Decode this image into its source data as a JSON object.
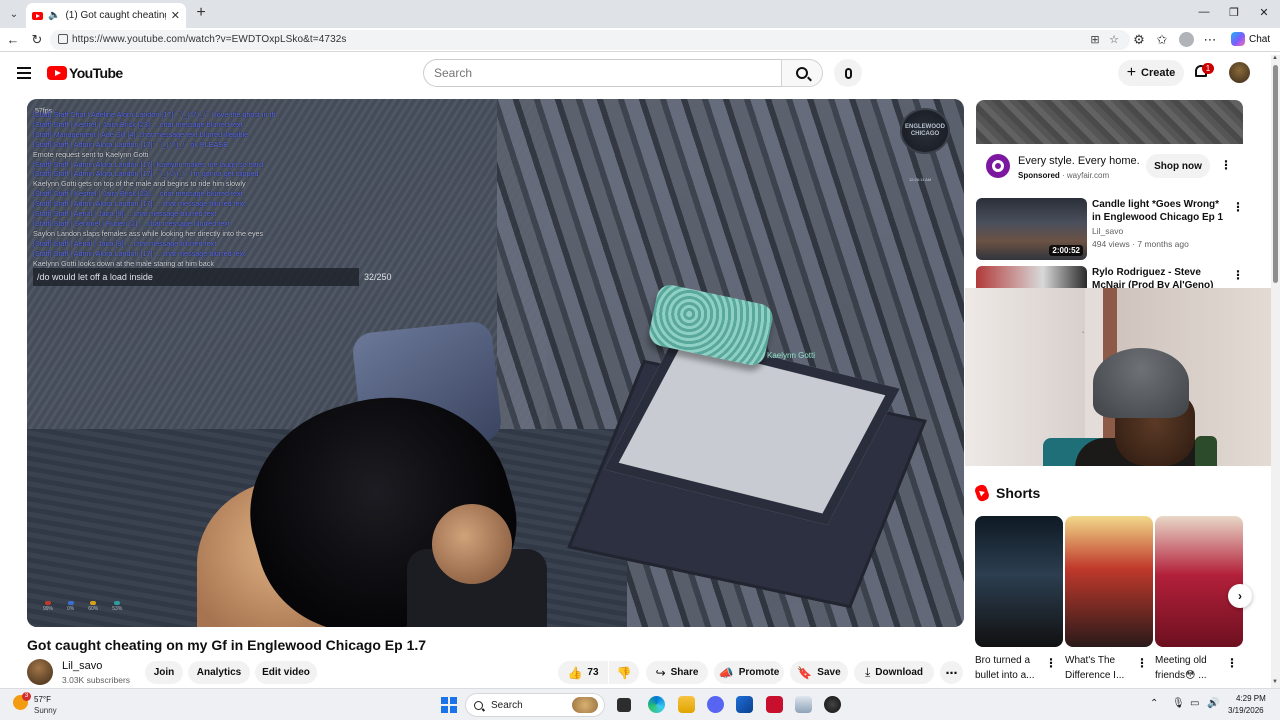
{
  "browser": {
    "tab_title": "(1) Got caught cheating on my Gf in Englewood Chicago Ep 1.7",
    "url": "https://www.youtube.com/watch?v=EWDTOxpLSko&t=4732s",
    "copilot_label": "Chat"
  },
  "header": {
    "logo_text": "YouTube",
    "search_placeholder": "Search",
    "create_label": "Create",
    "notification_count": "1"
  },
  "game_hud": {
    "fps": "57fps",
    "chat_lines": [
      "[Staff] Staff Chat | Adeline Alora Landon [17]: ¯\\_(ツ)_/¯ I love the ghost in th",
      "[Staff] Staff | Kestrel | Jaira Brisk [23]: ...chat message blurred text",
      "[Staff] Management | Ade Sill [4]: chat message text blurred illegible",
      "[Staff] Staff | Admin Alora Landon [17]: ¯\\_(ツ)_/¯ ok PLEASE",
      "Emote request sent to Kaelynn Gotti",
      "[Staff] Staff | Admin Alora Landon [17]: Kaelynn makes me laugh so hard",
      "[Staff] Staff | Admin Alora Landon [17]: ¯\\_(ツ)_/¯ I'm gonna get clipped",
      "Kaelynn Gotti gets on top of the male and begins to ride him slowly",
      "[Staff] Staff | Kestrel | Jaira Brisk [23]: ...chat message blurred text",
      "[Staff] Staff | Admin Alora Landon [17]: ...chat message blurred text",
      "[Staff] Staff | Aerial | Jaira [9]: ...chat message blurred text",
      "[Staff] Staff | Sentinel | Ruben [2]: ...chat message blurred text",
      "Saylon Landon slaps females ass while looking her directly into the eyes",
      "[Staff] Staff | Aerial | Jaira [9]: ...chat message blurred text",
      "[Staff] Staff | Admin Alora Landon [17]: ...chat message blurred text",
      "Kaelynn Gotti looks down at the male staring at him back"
    ],
    "chat_white": [
      false,
      false,
      false,
      false,
      true,
      false,
      false,
      true,
      false,
      false,
      false,
      false,
      true,
      false,
      false,
      true
    ],
    "command_text": "/do would let off a load inside",
    "command_count": "32/250",
    "logo_text": "ENGLEWOOD CHICAGO",
    "time_text": "12:26:11 AM",
    "nametag": "Kaelynn Gotti",
    "stats": [
      {
        "value": "99%",
        "color": "#c0392b"
      },
      {
        "value": "0%",
        "color": "#3b6fd1"
      },
      {
        "value": "60%",
        "color": "#d4a017"
      },
      {
        "value": "53%",
        "color": "#2e9ca0"
      }
    ]
  },
  "video": {
    "title": "Got caught cheating on my Gf in Englewood Chicago Ep 1.7",
    "channel": "Lil_savo",
    "subscribers": "3.03K subscribers",
    "join_label": "Join",
    "analytics_label": "Analytics",
    "edit_label": "Edit video",
    "likes": "73",
    "share_label": "Share",
    "promote_label": "Promote",
    "save_label": "Save",
    "download_label": "Download"
  },
  "ad": {
    "title": "Every style. Every home.",
    "sponsored": "Sponsored",
    "domain": "· wayfair.com",
    "cta": "Shop now",
    "accent": "#7b189f"
  },
  "recommendations": [
    {
      "title": "Candle light *Goes Wrong* in Englewood Chicago Ep 1",
      "channel": "Lil_savo",
      "meta": "494 views · 7 months ago",
      "duration": "2:00:52"
    },
    {
      "title": "Rylo Rodriguez - Steve McNair (Prod By Al'Geno)",
      "channel": "",
      "meta": "",
      "duration": ""
    }
  ],
  "shorts": {
    "label": "Shorts",
    "items": [
      {
        "title": "Bro turned a bullet into a..."
      },
      {
        "title": "What's The Difference I..."
      },
      {
        "title": "Meeting old friends😳 ..."
      }
    ]
  },
  "taskbar": {
    "temperature": "57°F",
    "condition": "Sunny",
    "weather_badge": "3",
    "search_label": "Search",
    "time": "4:29 PM",
    "date": "3/19/2026"
  }
}
